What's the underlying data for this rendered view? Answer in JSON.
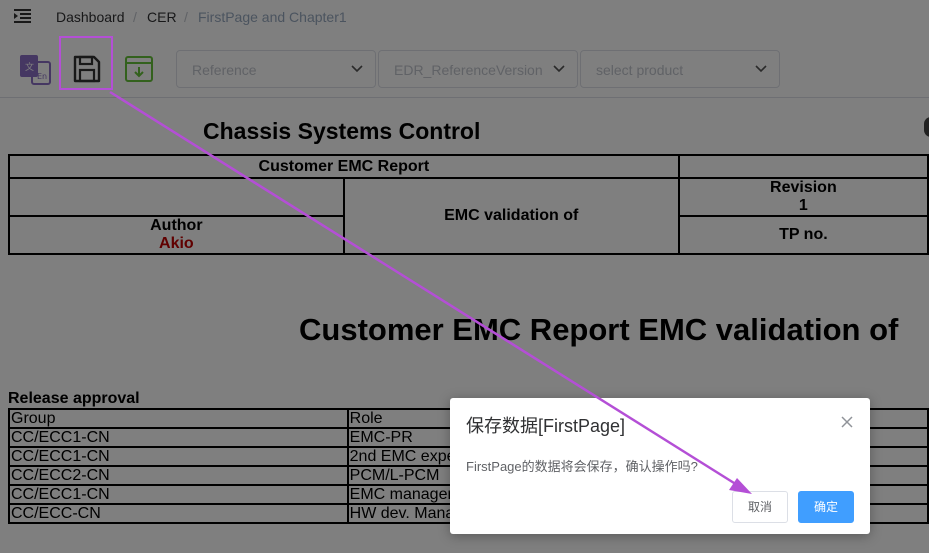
{
  "breadcrumb": {
    "items": [
      "Dashboard",
      "CER",
      "FirstPage and Chapter1"
    ],
    "separator": "/"
  },
  "toolbar": {
    "icons": [
      "translate-icon",
      "save-icon",
      "archive-download-icon"
    ],
    "selects": [
      {
        "placeholder": "Reference"
      },
      {
        "placeholder": "EDR_ReferenceVersion"
      },
      {
        "placeholder": "select product"
      }
    ]
  },
  "document": {
    "title": "Chassis Systems Control",
    "header_table": {
      "report_name": "Customer EMC Report",
      "validation_label": "EMC validation of",
      "revision_label": "Revision",
      "revision_value": "1",
      "author_label": "Author",
      "author_name": "Akio",
      "tp_label": "TP no."
    },
    "big_title": "Customer EMC Report EMC validation of",
    "release_approval": {
      "title": "Release approval",
      "columns": [
        "Group",
        "Role"
      ],
      "rows": [
        [
          "CC/ECC1-CN",
          "EMC-PR"
        ],
        [
          "CC/ECC1-CN",
          "2nd EMC expe"
        ],
        [
          "CC/ECC2-CN",
          "PCM/L-PCM"
        ],
        [
          "CC/ECC1-CN",
          "EMC manager"
        ],
        [
          "CC/ECC-CN",
          "HW dev. Mana"
        ]
      ]
    }
  },
  "dialog": {
    "title": "保存数据[FirstPage]",
    "message": "FirstPage的数据将会保存，确认操作吗?",
    "cancel_label": "取消",
    "ok_label": "确定"
  },
  "colors": {
    "primary": "#409eff",
    "annotation": "#b44fd6",
    "author": "#c00000",
    "archive_icon": "#67c23a",
    "translate_icon": "#8a6fc4"
  }
}
